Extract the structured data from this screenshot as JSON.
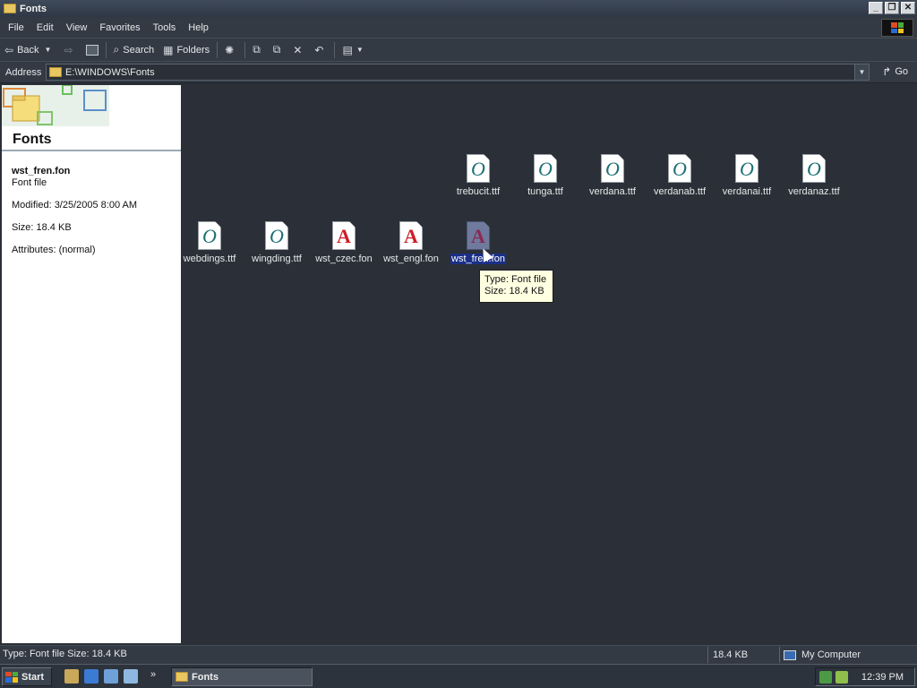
{
  "window": {
    "title": "Fonts"
  },
  "menu": [
    "File",
    "Edit",
    "View",
    "Favorites",
    "Tools",
    "Help"
  ],
  "toolbar": {
    "back": "Back",
    "search": "Search",
    "folders": "Folders"
  },
  "address": {
    "label": "Address",
    "path": "E:\\WINDOWS\\Fonts",
    "go": "Go"
  },
  "taskpane": {
    "title": "Fonts",
    "selected_name": "wst_fren.fon",
    "selected_type": "Font file",
    "modified": "Modified: 3/25/2005 8:00 AM",
    "size": "Size: 18.4 KB",
    "attributes": "Attributes: (normal)"
  },
  "files_row1": [
    {
      "name": "trebucit.ttf",
      "glyph": "O",
      "kind": "ttf"
    },
    {
      "name": "tunga.ttf",
      "glyph": "O",
      "kind": "ttf"
    },
    {
      "name": "verdana.ttf",
      "glyph": "O",
      "kind": "ttf"
    },
    {
      "name": "verdanab.ttf",
      "glyph": "O",
      "kind": "ttf"
    },
    {
      "name": "verdanai.ttf",
      "glyph": "O",
      "kind": "ttf"
    },
    {
      "name": "verdanaz.ttf",
      "glyph": "O",
      "kind": "ttf"
    }
  ],
  "files_row2": [
    {
      "name": "webdings.ttf",
      "glyph": "O",
      "kind": "ttf"
    },
    {
      "name": "wingding.ttf",
      "glyph": "O",
      "kind": "ttf"
    },
    {
      "name": "wst_czec.fon",
      "glyph": "A",
      "kind": "fon"
    },
    {
      "name": "wst_engl.fon",
      "glyph": "A",
      "kind": "fon"
    },
    {
      "name": "wst_fren.fon",
      "glyph": "A",
      "kind": "fon",
      "selected": true
    }
  ],
  "tooltip": {
    "line1": "Type: Font file",
    "line2": "Size: 18.4 KB"
  },
  "status": {
    "left": "Type: Font file Size: 18.4 KB",
    "size": "18.4 KB",
    "zone": "My Computer"
  },
  "taskbar": {
    "start": "Start",
    "task": "Fonts",
    "more": "»",
    "clock": "12:39 PM"
  }
}
